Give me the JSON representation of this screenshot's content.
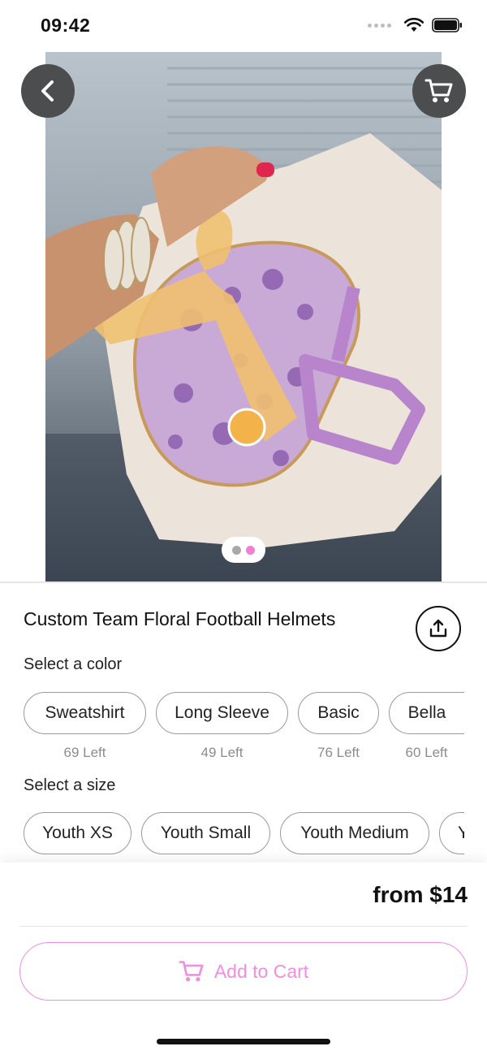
{
  "status_bar": {
    "time": "09:42"
  },
  "product": {
    "title": "Custom Team Floral Football Helmets",
    "price": "from $14"
  },
  "color_section": {
    "label": "Select a color",
    "options": [
      {
        "name": "Sweatshirt",
        "stock": "69 Left"
      },
      {
        "name": "Long Sleeve",
        "stock": "49 Left"
      },
      {
        "name": "Basic",
        "stock": "76 Left"
      },
      {
        "name": "Bella",
        "stock": "60 Left"
      }
    ]
  },
  "size_section": {
    "label": "Select a size",
    "options": [
      "Youth XS",
      "Youth Small",
      "Youth Medium",
      "Y"
    ]
  },
  "gallery": {
    "current_page": 2,
    "total_pages": 2
  },
  "actions": {
    "add_to_cart": "Add to Cart"
  },
  "colors": {
    "accent": "#f08ee0",
    "pager_active": "#f07fd6",
    "dark_button": "#4b4d4f"
  },
  "icons": [
    "back-chevron-icon",
    "cart-icon",
    "share-icon",
    "wifi-icon",
    "battery-icon"
  ]
}
